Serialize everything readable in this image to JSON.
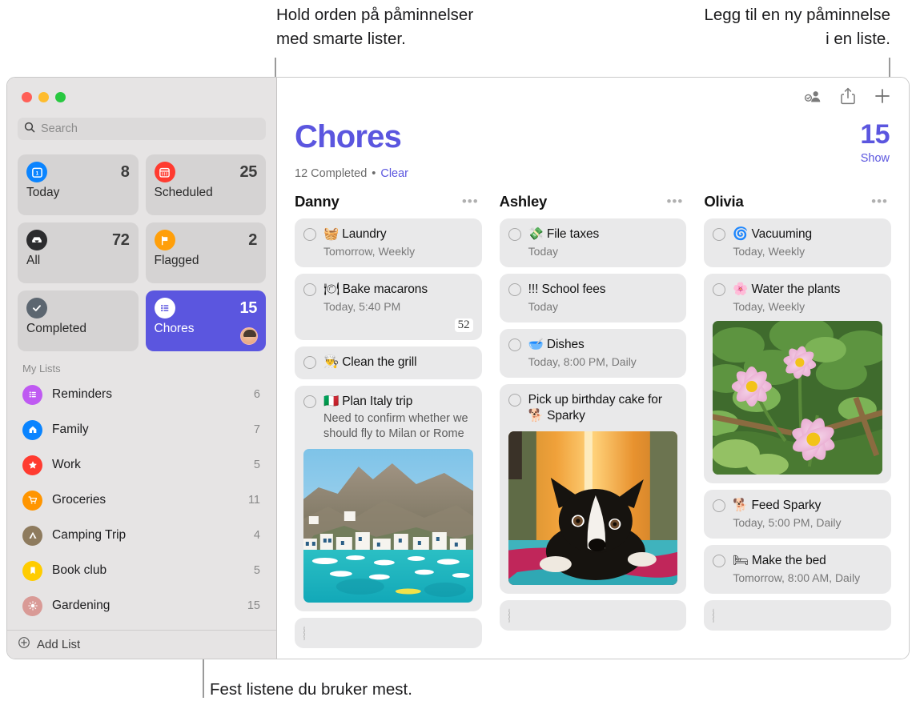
{
  "annotations": {
    "top_left": "Hold orden på påminnelser\nmed smarte lister.",
    "top_right": "Legg til en ny påminnelse\ni en liste.",
    "bottom": "Fest listene du bruker mest."
  },
  "window": {
    "traffic_lights": [
      "close",
      "minimize",
      "zoom"
    ]
  },
  "sidebar": {
    "search": {
      "placeholder": "Search",
      "value": ""
    },
    "smart_tiles": [
      {
        "label": "Today",
        "count": "8",
        "icon": "calendar-today-icon",
        "color": "#0a84ff",
        "active": false
      },
      {
        "label": "Scheduled",
        "count": "25",
        "icon": "calendar-icon",
        "color": "#ff3b30",
        "active": false
      },
      {
        "label": "All",
        "count": "72",
        "icon": "inbox-icon",
        "color": "#2c2c2e",
        "active": false
      },
      {
        "label": "Flagged",
        "count": "2",
        "icon": "flag-icon",
        "color": "#ff9f0a",
        "active": false
      },
      {
        "label": "Completed",
        "count": "",
        "icon": "checkmark-icon",
        "color": "#5c6670",
        "active": false
      },
      {
        "label": "Chores",
        "count": "15",
        "icon": "list-bullet-icon",
        "color": "#ffffff",
        "active": true
      }
    ],
    "my_lists_header": "My Lists",
    "lists": [
      {
        "name": "Reminders",
        "count": "6",
        "icon": "list-bullet-icon",
        "color": "#bf5af2"
      },
      {
        "name": "Family",
        "count": "7",
        "icon": "house-icon",
        "color": "#0a84ff"
      },
      {
        "name": "Work",
        "count": "5",
        "icon": "star-icon",
        "color": "#ff3b30"
      },
      {
        "name": "Groceries",
        "count": "11",
        "icon": "cart-icon",
        "color": "#ff9500"
      },
      {
        "name": "Camping Trip",
        "count": "4",
        "icon": "tent-icon",
        "color": "#8e7b5e"
      },
      {
        "name": "Book club",
        "count": "5",
        "icon": "bookmark-icon",
        "color": "#ffcc00"
      },
      {
        "name": "Gardening",
        "count": "15",
        "icon": "sun-icon",
        "color": "#d99a96"
      }
    ],
    "add_list_label": "Add List"
  },
  "toolbar": {
    "buttons": [
      {
        "name": "share-people-icon",
        "label": ""
      },
      {
        "name": "share-icon",
        "label": ""
      },
      {
        "name": "add-icon",
        "label": ""
      }
    ]
  },
  "main": {
    "title": "Chores",
    "count": "15",
    "show_label": "Show",
    "completed_text": "12 Completed",
    "separator": "•",
    "clear_label": "Clear",
    "accent_color": "#5b56df",
    "columns": [
      {
        "name": "Danny",
        "more_label": "•••",
        "items": [
          {
            "emoji": "🧺",
            "title": "Laundry",
            "sub": "Tomorrow, Weekly",
            "note": "",
            "badge": "",
            "thumb": ""
          },
          {
            "emoji": "🍽",
            "title": "Bake macarons",
            "sub": "Today, 5:40 PM",
            "note": "",
            "badge": "52",
            "thumb": ""
          },
          {
            "emoji": "👨‍🍳",
            "title": "Clean the grill",
            "sub": "",
            "note": "",
            "badge": "",
            "thumb": ""
          },
          {
            "emoji": "🇮🇹",
            "title": "Plan Italy trip",
            "sub": "",
            "note": "Need to confirm whether we should fly to Milan or Rome",
            "badge": "",
            "thumb": "italy-coast"
          },
          {
            "emoji": "",
            "title": "",
            "sub": "",
            "note": "",
            "badge": "",
            "thumb": ""
          }
        ]
      },
      {
        "name": "Ashley",
        "more_label": "•••",
        "items": [
          {
            "emoji": "💸",
            "title": "File taxes",
            "sub": "Today",
            "note": "",
            "badge": "",
            "thumb": ""
          },
          {
            "emoji": "",
            "title": "!!! School fees",
            "sub": "Today",
            "note": "",
            "badge": "",
            "thumb": ""
          },
          {
            "emoji": "🥣",
            "title": "Dishes",
            "sub": "Today, 8:00 PM, Daily",
            "note": "",
            "badge": "",
            "thumb": ""
          },
          {
            "emoji": "",
            "title": "Pick up birthday cake for 🐕 Sparky",
            "sub": "",
            "note": "",
            "badge": "",
            "thumb": "dog-photo"
          },
          {
            "emoji": "",
            "title": "",
            "sub": "",
            "note": "",
            "badge": "",
            "thumb": ""
          }
        ]
      },
      {
        "name": "Olivia",
        "more_label": "•••",
        "items": [
          {
            "emoji": "🌀",
            "title": "Vacuuming",
            "sub": "Today, Weekly",
            "note": "",
            "badge": "",
            "thumb": ""
          },
          {
            "emoji": "🌸",
            "title": "Water the plants",
            "sub": "Today, Weekly",
            "note": "",
            "badge": "",
            "thumb": "flowers-photo"
          },
          {
            "emoji": "🐕",
            "title": "Feed Sparky",
            "sub": "Today, 5:00 PM, Daily",
            "note": "",
            "badge": "",
            "thumb": ""
          },
          {
            "emoji": "🛏",
            "title": "Make the bed",
            "sub": "Tomorrow, 8:00 AM, Daily",
            "note": "",
            "badge": "",
            "thumb": ""
          },
          {
            "emoji": "",
            "title": "",
            "sub": "",
            "note": "",
            "badge": "",
            "thumb": ""
          }
        ]
      }
    ]
  }
}
